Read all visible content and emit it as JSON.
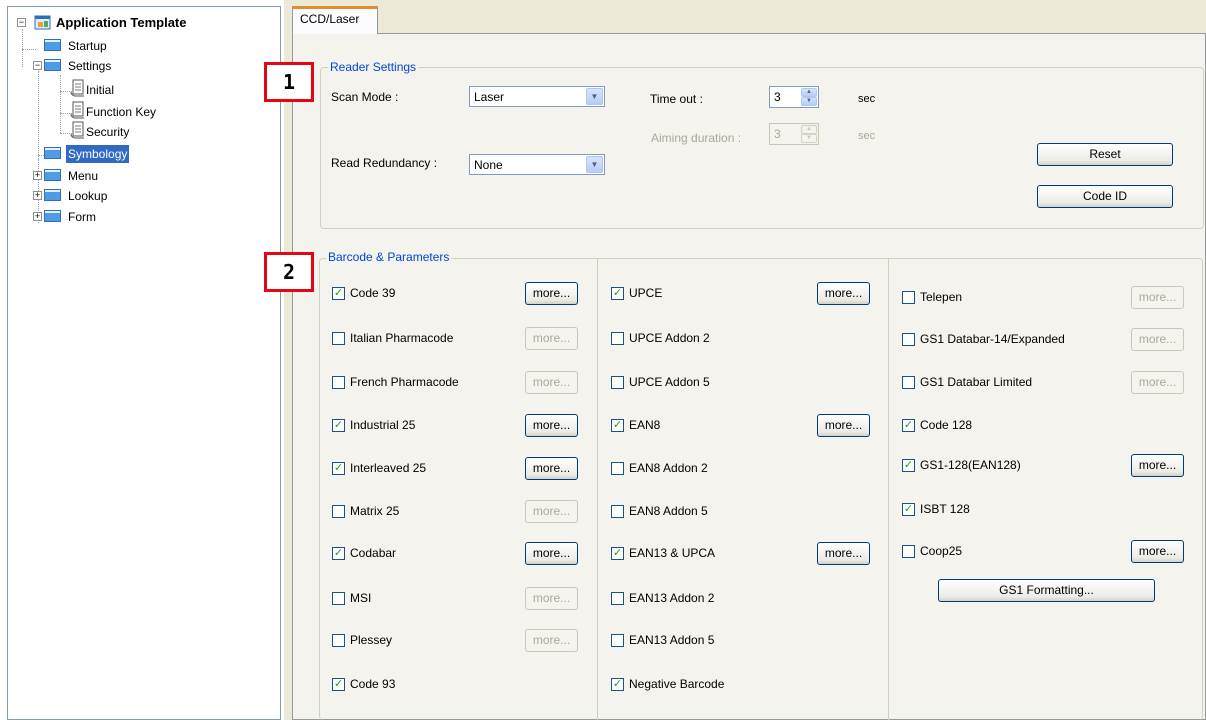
{
  "tree": {
    "root": "Application Template",
    "startup": "Startup",
    "settings": "Settings",
    "initial": "Initial",
    "function_key": "Function Key",
    "security": "Security",
    "symbology": "Symbology",
    "menu": "Menu",
    "lookup": "Lookup",
    "form": "Form",
    "expanded_glyph": "−",
    "collapsed_glyph": "+"
  },
  "tab": {
    "label": "CCD/Laser"
  },
  "reader": {
    "title": "Reader Settings",
    "scan_mode_label": "Scan Mode :",
    "scan_mode_value": "Laser",
    "timeout_label": "Time out :",
    "timeout_value": "3",
    "timeout_unit": "sec",
    "aiming_label": "Aiming duration :",
    "aiming_value": "3",
    "aiming_unit": "sec",
    "redundancy_label": "Read Redundancy :",
    "redundancy_value": "None",
    "reset_label": "Reset",
    "codeid_label": "Code ID"
  },
  "barcode": {
    "title": "Barcode & Parameters",
    "more_label": "more...",
    "check_glyph": "✓",
    "col1": [
      {
        "label": "Code 39",
        "checked": true,
        "more": true
      },
      {
        "label": "Italian Pharmacode",
        "checked": false,
        "more": false
      },
      {
        "label": "French Pharmacode",
        "checked": false,
        "more": false
      },
      {
        "label": "Industrial 25",
        "checked": true,
        "more": true
      },
      {
        "label": "Interleaved 25",
        "checked": true,
        "more": true
      },
      {
        "label": "Matrix 25",
        "checked": false,
        "more": false
      },
      {
        "label": "Codabar",
        "checked": true,
        "more": true
      },
      {
        "label": "MSI",
        "checked": false,
        "more": false
      },
      {
        "label": "Plessey",
        "checked": false,
        "more": false
      },
      {
        "label": "Code 93",
        "checked": true
      }
    ],
    "col2": [
      {
        "label": "UPCE",
        "checked": true,
        "more": true
      },
      {
        "label": "UPCE Addon 2",
        "checked": false
      },
      {
        "label": "UPCE Addon 5",
        "checked": false
      },
      {
        "label": "EAN8",
        "checked": true,
        "more": true
      },
      {
        "label": "EAN8 Addon 2",
        "checked": false
      },
      {
        "label": "EAN8 Addon 5",
        "checked": false
      },
      {
        "label": "EAN13 & UPCA",
        "checked": true,
        "more": true
      },
      {
        "label": "EAN13 Addon 2",
        "checked": false
      },
      {
        "label": "EAN13 Addon 5",
        "checked": false
      },
      {
        "label": "Negative Barcode",
        "checked": true
      }
    ],
    "col3": [
      {
        "label": "Telepen",
        "checked": false,
        "more": false
      },
      {
        "label": "GS1 Databar-14/Expanded",
        "checked": false,
        "more": false
      },
      {
        "label": "GS1 Databar Limited",
        "checked": false,
        "more": false
      },
      {
        "label": "Code 128",
        "checked": true
      },
      {
        "label": "GS1-128(EAN128)",
        "checked": true,
        "more": true
      },
      {
        "label": "ISBT 128",
        "checked": true
      },
      {
        "label": "Coop25",
        "checked": false,
        "more": true
      }
    ],
    "gs1_formatting": "GS1 Formatting..."
  },
  "markers": {
    "one": "1",
    "two": "2"
  }
}
